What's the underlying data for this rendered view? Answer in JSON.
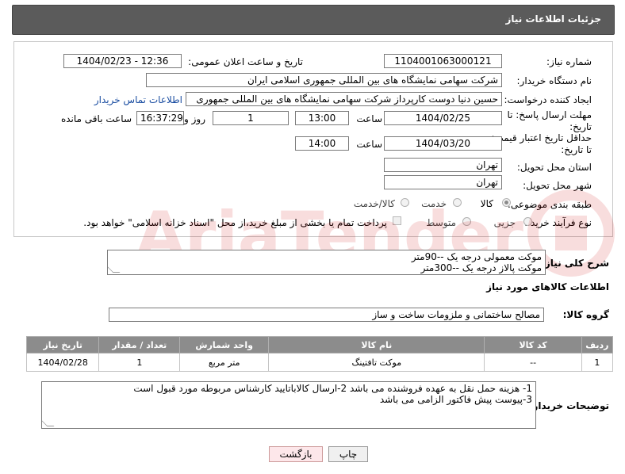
{
  "header": {
    "title": "جزئیات اطلاعات نیاز"
  },
  "form": {
    "need_number": {
      "label": "شماره نیاز:",
      "value": "1104001063000121"
    },
    "announce": {
      "label": "تاریخ و ساعت اعلان عمومی:",
      "value": "1404/02/23 - 12:36"
    },
    "buyer_org": {
      "label": "نام دستگاه خریدار:",
      "value": "شرکت سهامی نمایشگاه های بین المللی جمهوری اسلامی ایران"
    },
    "requester": {
      "label": "ایجاد کننده درخواست:",
      "value": "حسین دنیا دوست کارپرداز شرکت سهامی نمایشگاه های بین المللی جمهوری",
      "contact_link": "اطلاعات تماس خریدار"
    },
    "deadline": {
      "label_line1": "مهلت ارسال پاسخ: تا",
      "label_line2": "تاریخ:",
      "date": "1404/02/25",
      "time_label": "ساعت",
      "time": "13:00",
      "days": "1",
      "days_label": "روز و",
      "remaining": "16:37:29",
      "remaining_label": "ساعت باقی مانده"
    },
    "price_validity": {
      "label_line1": "حداقل تاریخ اعتبار قیمت:",
      "label_line2": "تا تاریخ:",
      "date": "1404/03/20",
      "time_label": "ساعت",
      "time": "14:00"
    },
    "province": {
      "label": "استان محل تحویل:",
      "value": "تهران"
    },
    "city": {
      "label": "شهر محل تحویل:",
      "value": "تهران"
    },
    "category": {
      "label": "طبقه بندی موضوعی:",
      "options": [
        "کالا",
        "خدمت",
        "کالا/خدمت"
      ],
      "selected": "کالا"
    },
    "process": {
      "label": "نوع فرآیند خرید :",
      "options": [
        "جزیی",
        "متوسط"
      ],
      "payment_note": "پرداخت تمام یا بخشی از مبلغ خرید،از محل \"اسناد خزانه اسلامی\" خواهد بود."
    }
  },
  "summary": {
    "label": "شرح کلی نیاز:",
    "lines": [
      "موکت معمولی درجه یک --90متر",
      "موکت پالاز درجه یک --300متر"
    ]
  },
  "goods_section": {
    "title": "اطلاعات کالاهای مورد نیاز",
    "group_label": "گروه کالا:",
    "group_value": "مصالح ساختمانی و ملزومات ساخت و ساز"
  },
  "table": {
    "headers": [
      "ردیف",
      "کد کالا",
      "نام کالا",
      "واحد شمارش",
      "تعداد / مقدار",
      "تاریخ نیاز"
    ],
    "rows": [
      [
        "1",
        "--",
        "موکت تافتینگ",
        "متر مربع",
        "1",
        "1404/02/28"
      ]
    ]
  },
  "buyer_notes": {
    "label": "توضیحات خریدار:",
    "lines": [
      "1- هزینه حمل نقل به عهده فروشنده می باشد 2-ارسال کالاباتایید کارشناس مربوطه مورد قبول است",
      "3-پیوست پیش فاکتور الزامی می باشد"
    ]
  },
  "buttons": {
    "print": "چاپ",
    "back": "بازگشت"
  },
  "colors": {
    "header_bg": "#5b5b5b",
    "table_header_bg": "#8c8c8c",
    "link": "#1a4da1",
    "back_btn_bg": "#fde7ea"
  }
}
